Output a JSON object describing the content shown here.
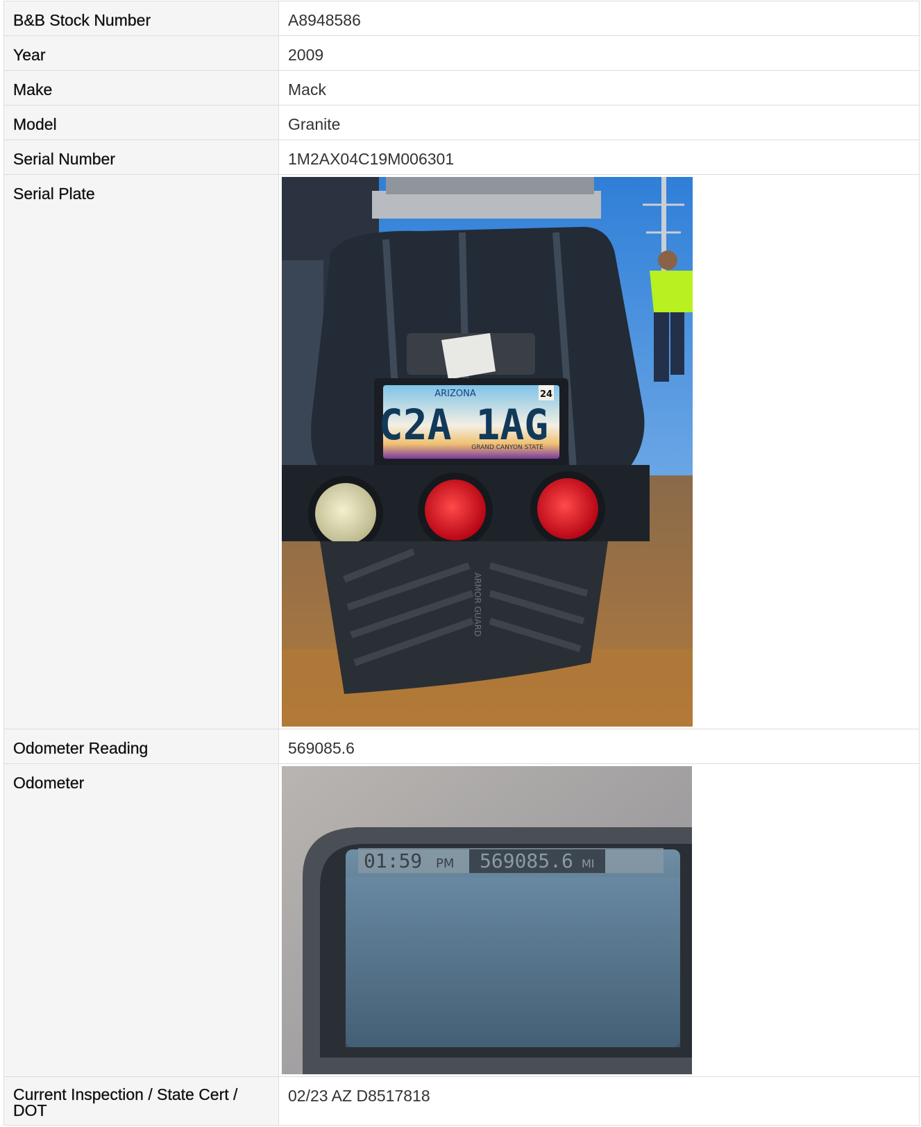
{
  "rows": [
    {
      "label": "B&B Stock Number",
      "value": "A8948586"
    },
    {
      "label": "Year",
      "value": "2009"
    },
    {
      "label": "Make",
      "value": "Mack"
    },
    {
      "label": "Model",
      "value": "Granite"
    },
    {
      "label": "Serial Number",
      "value": "1M2AX04C19M006301"
    },
    {
      "label": "Serial Plate"
    },
    {
      "label": "Odometer Reading",
      "value": "569085.6"
    },
    {
      "label": "Odometer"
    },
    {
      "label": "Current Inspection / State Cert / DOT",
      "value": "02/23 AZ D8517818"
    }
  ],
  "serial_plate_photo": {
    "plate_state": "ARIZONA",
    "plate_number": "C2A 1AG",
    "plate_slogan": "GRAND CANYON STATE",
    "plate_sticker": "24",
    "mudflap_text": "ARMOR GUARD"
  },
  "odometer_photo": {
    "clock": "01:59",
    "clock_suffix": "PM",
    "reading": "569085.6",
    "unit": "MI"
  }
}
